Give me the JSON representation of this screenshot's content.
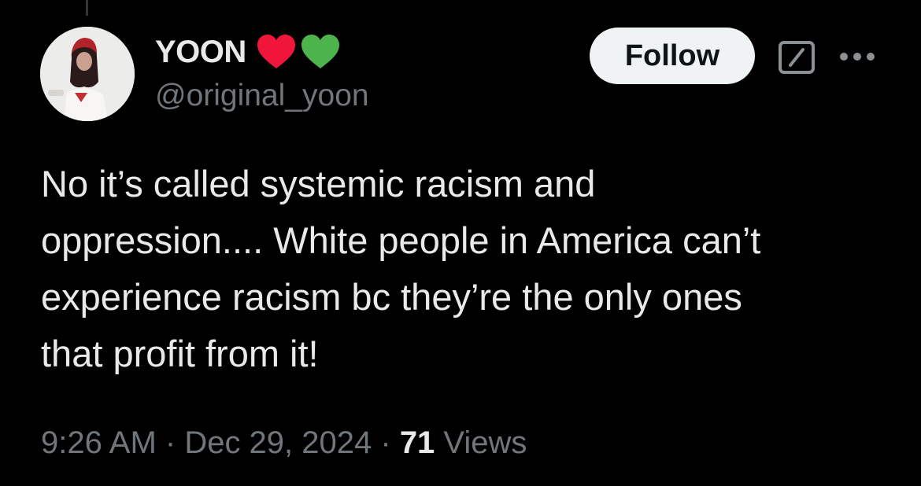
{
  "author": {
    "display_name": "YOON",
    "handle": "@original_yoon",
    "emoji": [
      {
        "name": "red-heart",
        "color": "#f0163b"
      },
      {
        "name": "green-heart",
        "color": "#4cb44a"
      }
    ]
  },
  "actions": {
    "follow_label": "Follow",
    "grok_icon": "grok-icon",
    "more_icon": "more-icon"
  },
  "tweet": {
    "text": "No it’s called systemic racism and\noppression.... White people in America can’t\nexperience racism bc they’re the only ones\nthat profit from it!"
  },
  "meta": {
    "time": "9:26 AM",
    "separator": " · ",
    "date": "Dec 29, 2024",
    "views_count": "71",
    "views_label": " Views"
  },
  "colors": {
    "background": "#000000",
    "primary_text": "#e7e9ea",
    "secondary_text": "#71767b",
    "follow_bg": "#eff3f4",
    "follow_text": "#0f1419"
  }
}
